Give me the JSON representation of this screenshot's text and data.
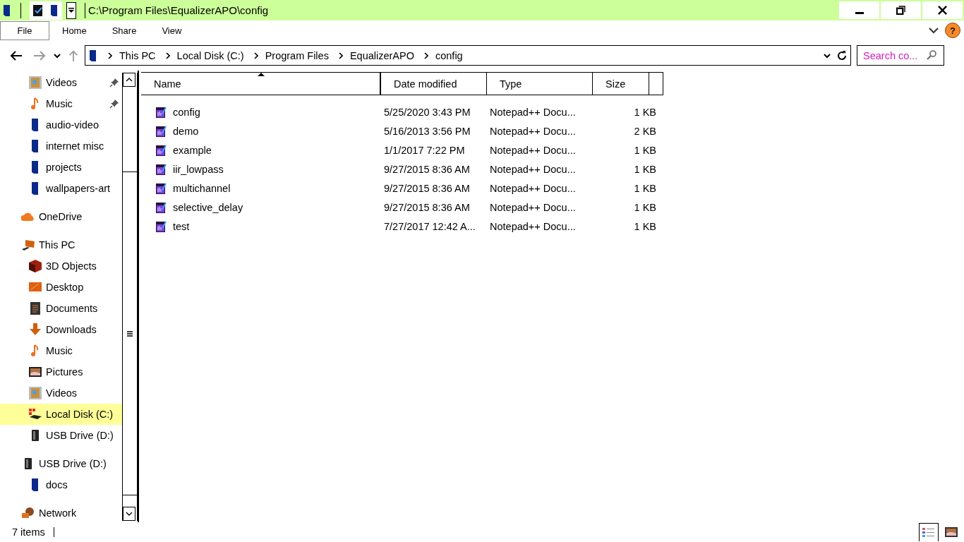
{
  "window": {
    "title": "C:\\Program Files\\EqualizerAPO\\config",
    "controls": [
      {
        "kind": "minimize"
      },
      {
        "kind": "restore"
      },
      {
        "kind": "close"
      }
    ]
  },
  "ribbon": {
    "tabs": [
      {
        "label": "File",
        "selected": true
      },
      {
        "label": "Home",
        "selected": false
      },
      {
        "label": "Share",
        "selected": false
      },
      {
        "label": "View",
        "selected": false
      }
    ],
    "help_label": "?"
  },
  "navigation": {
    "back_disabled": false,
    "forward_disabled": true,
    "up_disabled": true
  },
  "address": {
    "segments": [
      "This PC",
      "Local Disk (C:)",
      "Program Files",
      "EqualizerAPO",
      "config"
    ]
  },
  "search": {
    "placeholder": "Search co..."
  },
  "sidebar": {
    "items": [
      {
        "label": "Videos",
        "kind": "videos",
        "pinned": true,
        "selected": false
      },
      {
        "label": "Music",
        "kind": "music",
        "pinned": true,
        "selected": false
      },
      {
        "label": "audio-video",
        "kind": "folder",
        "pinned": false,
        "selected": false
      },
      {
        "label": "internet misc",
        "kind": "folder",
        "pinned": false,
        "selected": false
      },
      {
        "label": "projects",
        "kind": "folder",
        "pinned": false,
        "selected": false
      },
      {
        "label": "wallpapers-art",
        "kind": "folder",
        "pinned": false,
        "selected": false
      }
    ],
    "tree": [
      {
        "label": "OneDrive",
        "kind": "onedrive",
        "selected": false
      },
      {
        "label": "This PC",
        "kind": "pc",
        "selected": false,
        "children": [
          {
            "label": "3D Objects",
            "kind": "objects3d",
            "selected": false
          },
          {
            "label": "Desktop",
            "kind": "desktop",
            "selected": false
          },
          {
            "label": "Documents",
            "kind": "documents",
            "selected": false
          },
          {
            "label": "Downloads",
            "kind": "downloads",
            "selected": false
          },
          {
            "label": "Music",
            "kind": "music",
            "selected": false
          },
          {
            "label": "Pictures",
            "kind": "pictures",
            "selected": false
          },
          {
            "label": "Videos",
            "kind": "videos",
            "selected": false
          },
          {
            "label": "Local Disk (C:)",
            "kind": "disk",
            "selected": true
          },
          {
            "label": "USB Drive (D:)",
            "kind": "usb",
            "selected": false
          }
        ]
      },
      {
        "label": "USB Drive (D:)",
        "kind": "usb",
        "selected": false,
        "children": [
          {
            "label": "docs",
            "kind": "folder",
            "selected": false
          }
        ]
      },
      {
        "label": "Network",
        "kind": "network",
        "selected": false
      }
    ]
  },
  "table": {
    "columns": [
      {
        "label": "Name",
        "sorted": true
      },
      {
        "label": "Date modified",
        "sorted": false
      },
      {
        "label": "Type",
        "sorted": false
      },
      {
        "label": "Size",
        "sorted": false
      }
    ],
    "rows": [
      {
        "name": "config",
        "date": "5/25/2020 3:43 PM",
        "type": "Notepad++ Docu...",
        "size": "1 KB"
      },
      {
        "name": "demo",
        "date": "5/16/2013 3:56 PM",
        "type": "Notepad++ Docu...",
        "size": "2 KB"
      },
      {
        "name": "example",
        "date": "1/1/2017 7:22 PM",
        "type": "Notepad++ Docu...",
        "size": "1 KB"
      },
      {
        "name": "iir_lowpass",
        "date": "9/27/2015 8:36 AM",
        "type": "Notepad++ Docu...",
        "size": "1 KB"
      },
      {
        "name": "multichannel",
        "date": "9/27/2015 8:36 AM",
        "type": "Notepad++ Docu...",
        "size": "1 KB"
      },
      {
        "name": "selective_delay",
        "date": "9/27/2015 8:36 AM",
        "type": "Notepad++ Docu...",
        "size": "1 KB"
      },
      {
        "name": "test",
        "date": "7/27/2017 12:42 A...",
        "type": "Notepad++ Docu...",
        "size": "1 KB"
      }
    ]
  },
  "status_bar": {
    "count": "7 items",
    "views": [
      {
        "kind": "details",
        "selected": true
      },
      {
        "kind": "large_icons",
        "selected": false
      }
    ]
  }
}
